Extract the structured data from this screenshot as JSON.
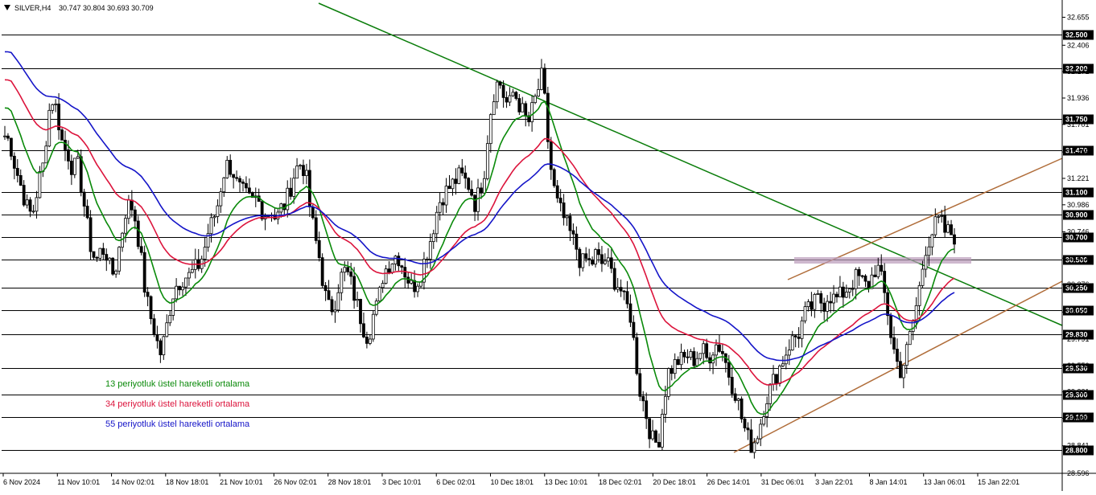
{
  "header": {
    "symbol": "SILVER,H4",
    "ohlc": "30.747 30.804 30.693 30.709"
  },
  "chart_data": {
    "type": "candlestick",
    "title": "SILVER,H4",
    "ylim": [
      28.596,
      32.78
    ],
    "grid": false,
    "y_ticks": [
      "32.655",
      "32.406",
      "32.171",
      "31.936",
      "31.701",
      "31.456",
      "31.221",
      "30.986",
      "30.746",
      "30.511",
      "30.276",
      "30.031",
      "29.791",
      "29.556",
      "29.321",
      "29.086",
      "28.841",
      "28.596"
    ],
    "x_ticks": [
      "6 Nov 2024",
      "11 Nov 10:01",
      "14 Nov 02:01",
      "18 Nov 18:01",
      "21 Nov 10:01",
      "26 Nov 02:01",
      "28 Nov 18:01",
      "3 Dec 10:01",
      "6 Dec 02:01",
      "10 Dec 18:01",
      "13 Dec 10:01",
      "18 Dec 02:01",
      "20 Dec 18:01",
      "26 Dec 14:01",
      "31 Dec 06:01",
      "3 Jan 22:01",
      "8 Jan 14:01",
      "13 Jan 06:01",
      "15 Jan 22:01"
    ],
    "horizontal_levels": [
      "32.500",
      "32.200",
      "31.750",
      "31.470",
      "31.100",
      "30.900",
      "30.700",
      "30.500",
      "30.250",
      "30.050",
      "29.830",
      "29.530",
      "29.300",
      "29.100",
      "28.800"
    ],
    "legend": [
      {
        "name": "13 periyotluk üstel hareketli ortalama",
        "color": "#0a8a0a"
      },
      {
        "name": "34 periyotluk üstel hareketli ortalama",
        "color": "#dc143c"
      },
      {
        "name": "55 periyotluk üstel hareketli ortalama",
        "color": "#1515c8"
      }
    ],
    "close_series": [
      31.6,
      31.55,
      31.35,
      31.2,
      31.05,
      30.9,
      30.95,
      31.2,
      31.35,
      31.8,
      31.95,
      31.75,
      31.5,
      31.45,
      31.3,
      31.35,
      31.1,
      30.8,
      30.55,
      30.5,
      30.6,
      30.55,
      30.35,
      30.45,
      30.7,
      30.95,
      31.0,
      30.85,
      30.55,
      30.2,
      30.0,
      29.85,
      29.65,
      29.8,
      30.05,
      30.25,
      30.3,
      30.35,
      30.35,
      30.4,
      30.45,
      30.55,
      30.75,
      30.85,
      31.0,
      31.25,
      31.35,
      31.3,
      31.15,
      31.1,
      31.05,
      31.0,
      31.05,
      30.95,
      30.9,
      30.95,
      30.85,
      30.95,
      31.0,
      31.15,
      31.3,
      31.35,
      31.3,
      30.95,
      30.7,
      30.5,
      30.2,
      30.05,
      30.1,
      30.3,
      30.4,
      30.35,
      30.2,
      30.05,
      29.9,
      29.8,
      30.0,
      30.1,
      30.35,
      30.45,
      30.5,
      30.55,
      30.45,
      30.35,
      30.25,
      30.3,
      30.4,
      30.55,
      30.7,
      30.9,
      31.05,
      31.1,
      31.15,
      31.2,
      31.25,
      31.2,
      31.15,
      31.0,
      31.1,
      31.3,
      31.75,
      32.0,
      32.1,
      31.95,
      31.85,
      32.0,
      31.9,
      31.8,
      31.7,
      31.85,
      32.0,
      32.15,
      31.6,
      31.2,
      31.0,
      30.9,
      30.8,
      30.7,
      30.6,
      30.45,
      30.5,
      30.45,
      30.55,
      30.45,
      30.5,
      30.4,
      30.3,
      30.25,
      30.1,
      30.05,
      29.7,
      29.35,
      29.2,
      29.0,
      28.85,
      28.9,
      29.25,
      29.5,
      29.55,
      29.6,
      29.6,
      29.65,
      29.6,
      29.65,
      29.7,
      29.6,
      29.7,
      29.75,
      29.7,
      29.55,
      29.4,
      29.3,
      29.1,
      28.95,
      28.85,
      28.9,
      29.05,
      29.25,
      29.35,
      29.45,
      29.55,
      29.65,
      29.75,
      29.8,
      29.85,
      30.0,
      30.05,
      30.1,
      30.15,
      30.1,
      30.2,
      30.15,
      30.15,
      30.2,
      30.25,
      30.3,
      30.35,
      30.3,
      30.25,
      30.35,
      30.45,
      30.3,
      30.1,
      29.8,
      29.6,
      29.5,
      29.65,
      29.85,
      30.05,
      30.3,
      30.6,
      30.7,
      30.8,
      30.85,
      30.75,
      30.74,
      30.71
    ]
  }
}
